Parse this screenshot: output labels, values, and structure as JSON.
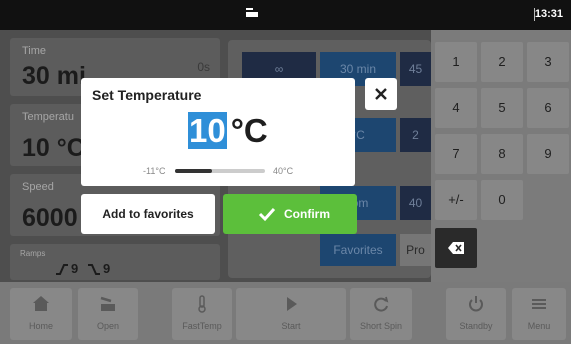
{
  "status_bar": {
    "time": "13:31"
  },
  "params": {
    "time": {
      "label": "Time",
      "value": "30 mi",
      "sub": "0s"
    },
    "temperature": {
      "label": "Temperatu",
      "value": "10 °C"
    },
    "speed": {
      "label": "Speed",
      "value": "6000"
    },
    "ramps": {
      "label": "Ramps",
      "up": "9",
      "down": "9"
    }
  },
  "quick_select": {
    "row1": [
      "∞",
      "30 min",
      "45"
    ],
    "row2": [
      "°C",
      "2"
    ],
    "row3": [
      "rpm",
      "40"
    ],
    "tabs": [
      "Favorites",
      "Pro"
    ]
  },
  "keypad": {
    "keys": [
      "1",
      "2",
      "3",
      "4",
      "5",
      "6",
      "7",
      "8",
      "9",
      "+/-",
      "0"
    ]
  },
  "toolbar": {
    "items": [
      {
        "label": "Home",
        "icon": "home-icon"
      },
      {
        "label": "Open",
        "icon": "open-lid-icon"
      },
      {
        "label": "FastTemp",
        "icon": "thermometer-icon"
      },
      {
        "label": "Start",
        "icon": "play-icon"
      },
      {
        "label": "Short Spin",
        "icon": "refresh-icon"
      },
      {
        "label": "Standby",
        "icon": "power-icon"
      },
      {
        "label": "Menu",
        "icon": "menu-icon"
      }
    ]
  },
  "dialog": {
    "title": "Set Temperature",
    "value": "10",
    "unit": "°C",
    "min_label": "-11°C",
    "max_label": "40°C",
    "range_fraction": 0.41,
    "favorites_label": "Add to favorites",
    "confirm_label": "Confirm"
  },
  "colors": {
    "confirm": "#5cbf3b",
    "selection": "#2f8fd8",
    "chip": "#1f2b44"
  }
}
